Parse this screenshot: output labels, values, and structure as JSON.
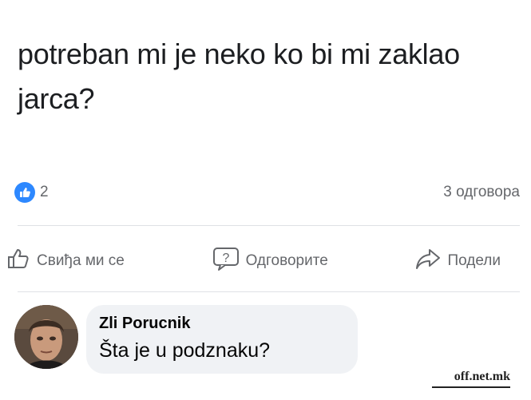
{
  "post": {
    "text": "potreban mi je neko ko bi mi zaklao jarca?"
  },
  "stats": {
    "reaction_count": "2",
    "reaction_icon": "thumbs-up-icon",
    "reply_count": "3 одговора"
  },
  "actions": {
    "like_label": "Свиђа ми се",
    "reply_label": "Одговорите",
    "share_label": "Подели"
  },
  "comment": {
    "author": "Zli Porucnik",
    "text": "Šta je u podznaku?"
  },
  "watermark": {
    "text": "off.net.mk"
  },
  "colors": {
    "accent": "#2d88ff",
    "muted_text": "#65676b",
    "bubble": "#f0f2f5"
  }
}
